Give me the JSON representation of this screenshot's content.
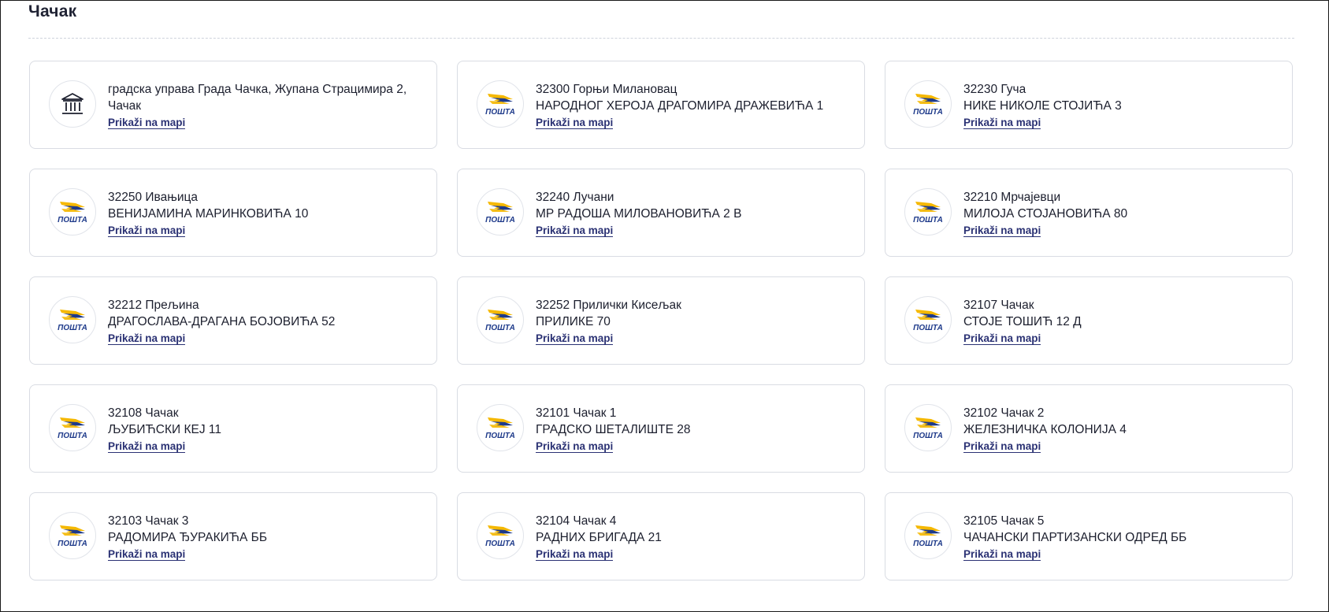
{
  "page": {
    "title": "Чачак"
  },
  "map_link_label": "Prikaži na mapi",
  "logo_text": "ПОШТА",
  "colors": {
    "posta_yellow": "#f5b800",
    "posta_blue": "#1e3a8a",
    "link": "#2b3274",
    "card_border": "#d9dce3"
  },
  "locations": [
    {
      "icon": "city-hall-icon",
      "line1": "градска управа Града Чачка, Жупана Страцимира 2, Чачак",
      "line2": ""
    },
    {
      "icon": "posta-logo-icon",
      "line1": "32300 Горњи Милановац",
      "line2": "НАРОДНОГ ХЕРОЈА ДРАГОМИРА ДРАЖЕВИЋА 1"
    },
    {
      "icon": "posta-logo-icon",
      "line1": "32230 Гуча",
      "line2": "НИКЕ НИКОЛЕ СТОЈИЋА 3"
    },
    {
      "icon": "posta-logo-icon",
      "line1": "32250 Ивањица",
      "line2": "ВЕНИЈАМИНА МАРИНКОВИЋА 10"
    },
    {
      "icon": "posta-logo-icon",
      "line1": "32240 Лучани",
      "line2": "МР РАДОША МИЛОВАНОВИЋА 2 В"
    },
    {
      "icon": "posta-logo-icon",
      "line1": "32210 Мрчајевци",
      "line2": "МИЛОЈА СТОЈАНОВИЋА 80"
    },
    {
      "icon": "posta-logo-icon",
      "line1": "32212 Прељина",
      "line2": "ДРАГОСЛАВА-ДРАГАНА БОЈОВИЋА 52"
    },
    {
      "icon": "posta-logo-icon",
      "line1": "32252 Прилички Кисељак",
      "line2": "ПРИЛИКЕ 70"
    },
    {
      "icon": "posta-logo-icon",
      "line1": "32107 Чачак",
      "line2": "СТОЈЕ ТОШИЋ 12 Д"
    },
    {
      "icon": "posta-logo-icon",
      "line1": "32108 Чачак",
      "line2": "ЉУБИЋСКИ КЕЈ 11"
    },
    {
      "icon": "posta-logo-icon",
      "line1": "32101 Чачак 1",
      "line2": "ГРАДСКО ШЕТАЛИШТЕ 28"
    },
    {
      "icon": "posta-logo-icon",
      "line1": "32102 Чачак 2",
      "line2": "ЖЕЛЕЗНИЧКА КОЛОНИЈА 4"
    },
    {
      "icon": "posta-logo-icon",
      "line1": "32103 Чачак 3",
      "line2": "РАДОМИРА ЂУРАКИЋА ББ"
    },
    {
      "icon": "posta-logo-icon",
      "line1": "32104 Чачак 4",
      "line2": "РАДНИХ БРИГАДА 21"
    },
    {
      "icon": "posta-logo-icon",
      "line1": "32105 Чачак 5",
      "line2": "ЧАЧАНСКИ ПАРТИЗАНСКИ ОДРЕД ББ"
    }
  ]
}
